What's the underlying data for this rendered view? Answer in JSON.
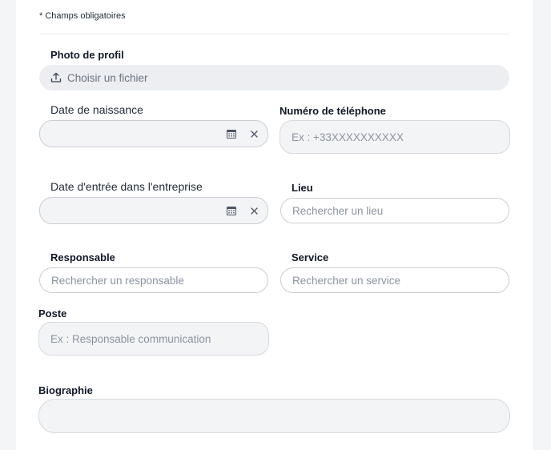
{
  "form": {
    "required_note": "* Champs obligatoires",
    "photo": {
      "label": "Photo de profil",
      "button_label": "Choisir un fichier",
      "icon": "upload-icon"
    },
    "birth_date": {
      "label": "Date de naissance",
      "value": ""
    },
    "phone": {
      "label": "Numéro de téléphone",
      "placeholder": "Ex : +33XXXXXXXXXX"
    },
    "hire_date": {
      "label": "Date d'entrée dans l'entreprise",
      "value": ""
    },
    "location": {
      "label": "Lieu",
      "placeholder": "Rechercher un lieu"
    },
    "manager": {
      "label": "Responsable",
      "placeholder": "Rechercher un responsable"
    },
    "service": {
      "label": "Service",
      "placeholder": "Rechercher un service"
    },
    "position": {
      "label": "Poste",
      "placeholder": "Ex : Responsable communication"
    },
    "bio": {
      "label": "Biographie",
      "value": ""
    }
  },
  "colors": {
    "field_border": "#c9cdd3",
    "field_fill": "#f3f4f6",
    "placeholder": "#8b93a1",
    "page_bg": "#f4f5f7"
  }
}
